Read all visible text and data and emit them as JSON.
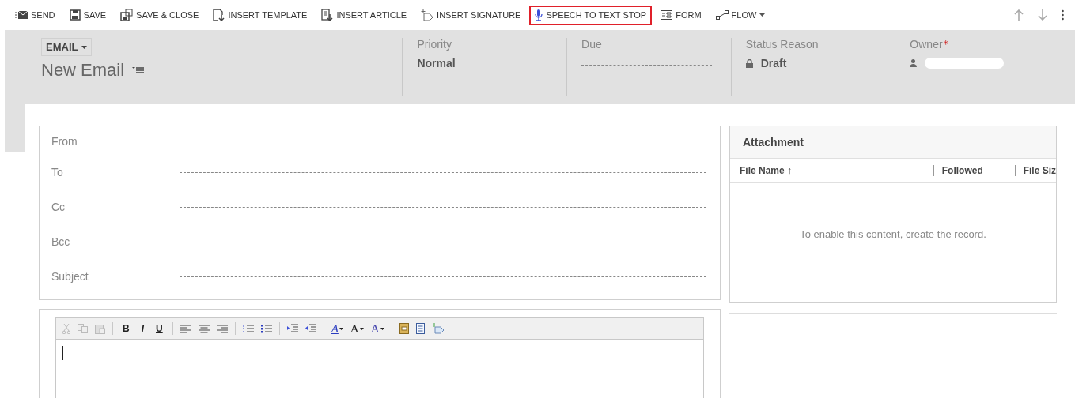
{
  "toolbar": [
    {
      "kind": "send",
      "label": "SEND",
      "highlighted": false
    },
    {
      "kind": "save",
      "label": "SAVE",
      "highlighted": false
    },
    {
      "kind": "save-close",
      "label": "SAVE & CLOSE",
      "highlighted": false
    },
    {
      "kind": "template",
      "label": "INSERT TEMPLATE",
      "highlighted": false
    },
    {
      "kind": "article",
      "label": "INSERT ARTICLE",
      "highlighted": false
    },
    {
      "kind": "signature",
      "label": "INSERT SIGNATURE",
      "highlighted": false
    },
    {
      "kind": "mic",
      "label": "SPEECH TO TEXT STOP",
      "highlighted": true
    },
    {
      "kind": "form",
      "label": "FORM",
      "highlighted": false
    },
    {
      "kind": "flow",
      "label": "FLOW",
      "highlighted": false
    }
  ],
  "header": {
    "entity": "EMAIL",
    "title": "New Email",
    "fields": [
      {
        "kind": "text",
        "label": "Priority",
        "value": "Normal"
      },
      {
        "kind": "empty",
        "label": "Due"
      },
      {
        "kind": "locked",
        "label": "Status Reason",
        "value": "Draft"
      },
      {
        "kind": "owner",
        "label": "Owner",
        "required_mark": "*"
      }
    ]
  },
  "form": {
    "fields": [
      {
        "label": "From",
        "dashed": false
      },
      {
        "label": "To",
        "dashed": true
      },
      {
        "label": "Cc",
        "dashed": true
      },
      {
        "label": "Bcc",
        "dashed": true
      },
      {
        "label": "Subject",
        "dashed": true
      }
    ]
  },
  "attachment": {
    "title": "Attachment",
    "columns": [
      {
        "label": "File Name ↑"
      },
      {
        "label": "Followed"
      },
      {
        "label": "File Siz"
      }
    ],
    "empty_message": "To enable this content, create the record."
  },
  "editor": {
    "format_buttons": [
      "B",
      "I",
      "U"
    ],
    "font_buttons": [
      "A",
      "A",
      "A"
    ]
  }
}
